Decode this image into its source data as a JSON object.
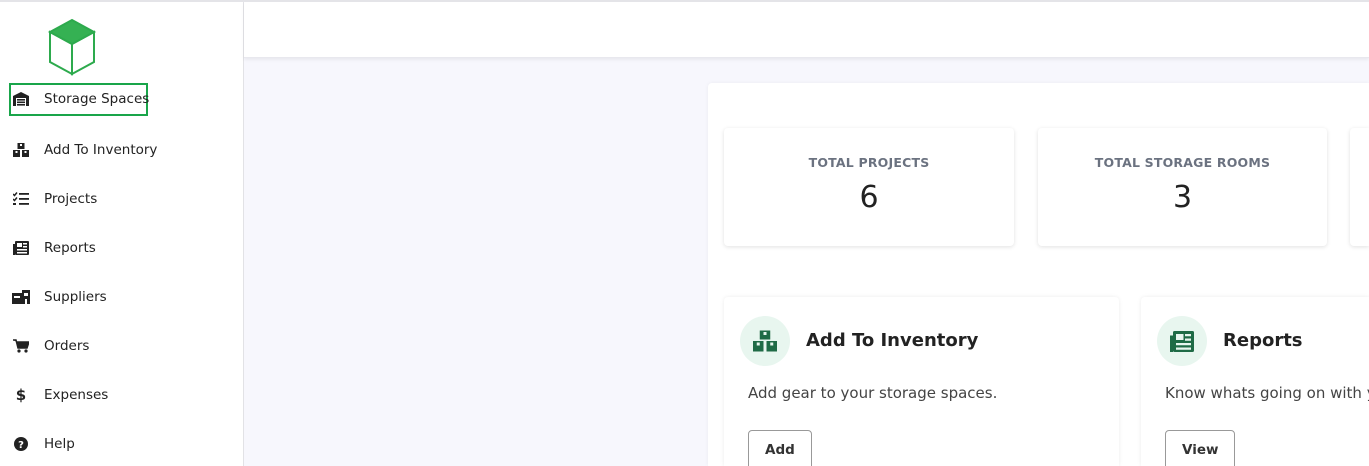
{
  "sidebar": {
    "items": [
      {
        "label": "Storage Spaces",
        "icon": "warehouse-icon",
        "active": true
      },
      {
        "label": "Add To Inventory",
        "icon": "boxes-icon"
      },
      {
        "label": "Projects",
        "icon": "tasks-icon"
      },
      {
        "label": "Reports",
        "icon": "newspaper-icon"
      },
      {
        "label": "Suppliers",
        "icon": "store-icon"
      },
      {
        "label": "Orders",
        "icon": "cart-icon"
      },
      {
        "label": "Expenses",
        "icon": "dollar-icon"
      },
      {
        "label": "Help",
        "icon": "question-circle-icon"
      }
    ]
  },
  "stats": [
    {
      "title": "TOTAL PROJECTS",
      "value": "6"
    },
    {
      "title": "TOTAL STORAGE ROOMS",
      "value": "3"
    }
  ],
  "features": [
    {
      "title": "Add To Inventory",
      "description": "Add gear to your storage spaces.",
      "button": "Add",
      "icon": "boxes-icon"
    },
    {
      "title": "Reports",
      "description": "Know whats going on with y",
      "button": "View",
      "icon": "newspaper-icon"
    }
  ],
  "colors": {
    "accent": "#19a54a",
    "icon_bg": "#e8f6ef",
    "icon_fg": "#1f6b46"
  }
}
